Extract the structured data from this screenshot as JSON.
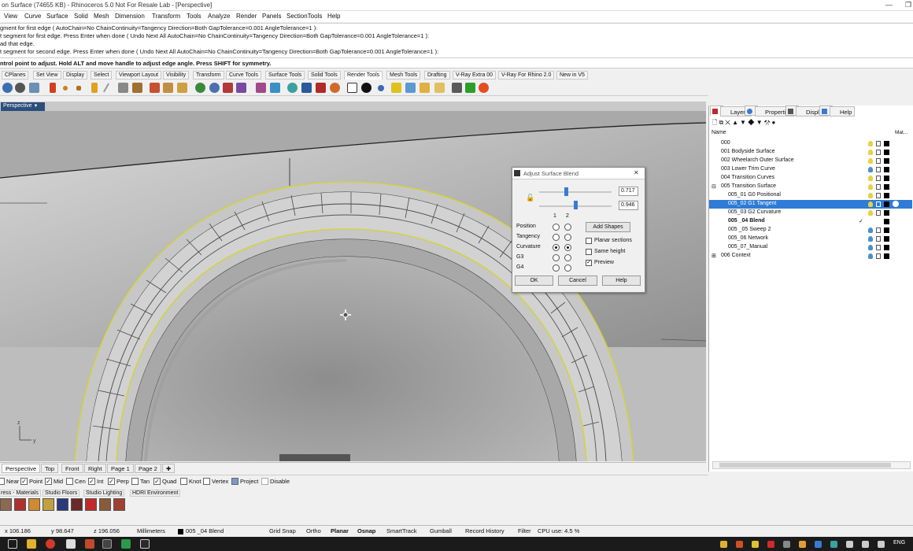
{
  "window": {
    "title": "on Surface (74655 KB) - Rhinoceros 5.0 Not For Resale Lab - [Perspective]",
    "restore_glyph": "❐"
  },
  "menu": [
    "View",
    "Curve",
    "Surface",
    "Solid",
    "Mesh",
    "Dimension",
    "Transform",
    "Tools",
    "Analyze",
    "Render",
    "Panels",
    "SectionTools",
    "Help"
  ],
  "command_history": [
    "gment for first edge ( AutoChain=No  ChainContinuity=Tangency  Direction=Both  GapTolerance=0.001  AngleTolerance=1 ):",
    "t segment for first edge. Press Enter when done ( Undo  Next  All  AutoChain=No  ChainContinuity=Tangency  Direction=Both  GapTolerance=0.001  AngleTolerance=1 ):",
    "ad that edge.",
    "t segment for second edge. Press Enter when done ( Undo  Next  All  AutoChain=No  ChainContinuity=Tangency  Direction=Both  GapTolerance=0.001  AngleTolerance=1 ):"
  ],
  "command_prompt": "ntrol point to adjust. Hold ALT and move handle to adjust edge angle. Press SHIFT for symmetry.",
  "toolbar_tabs": [
    "CPlanes",
    "Set View",
    "Display",
    "Select",
    "Viewport Layout",
    "Visibility",
    "Transform",
    "Curve Tools",
    "Surface Tools",
    "Solid Tools",
    "Render Tools",
    "Mesh Tools",
    "Drafting",
    "V-Ray Extra 00",
    "V-Ray For Rhino 2.0",
    "New in V5"
  ],
  "active_toolbar_tab": "Render Tools",
  "viewport": {
    "title": "Perspective",
    "axis_z": "z",
    "axis_y": "y"
  },
  "viewport_tabs": [
    "Perspective",
    "Top",
    "Front",
    "Right",
    "Page 1",
    "Page 2"
  ],
  "add_tab_glyph": "✚",
  "osnaps": [
    {
      "label": "Near",
      "checked": false
    },
    {
      "label": "Point",
      "checked": true
    },
    {
      "label": "Mid",
      "checked": true
    },
    {
      "label": "Cen",
      "checked": false
    },
    {
      "label": "Int",
      "checked": true
    },
    {
      "label": "Perp",
      "checked": true
    },
    {
      "label": "Tan",
      "checked": false
    },
    {
      "label": "Quad",
      "checked": true
    },
    {
      "label": "Knot",
      "checked": false
    },
    {
      "label": "Vertex",
      "checked": false
    },
    {
      "label": "Project",
      "checked": true
    },
    {
      "label": "Disable",
      "checked": false
    }
  ],
  "material_tabs": [
    "ress - Materials",
    "Studio Floors",
    "Studio Lighting",
    "HDRI Environment"
  ],
  "status": {
    "x": "x 106.186",
    "y": "y 98.647",
    "z": "z 196.056",
    "units": "Millimeters",
    "layer": "005 _04 Blend",
    "toggles": [
      "Grid Snap",
      "Ortho",
      "Planar",
      "Osnap",
      "SmartTrack",
      "Gumball",
      "Record History",
      "Filter"
    ],
    "cpu": "CPU use: 4.5 %"
  },
  "taskbar": {
    "lang": "ENG"
  },
  "panel": {
    "tabs": [
      "Layers",
      "Properties",
      "Display",
      "Help"
    ],
    "active_tab": "Layers",
    "column_name": "Name",
    "column_mat": "Mat...",
    "layers": [
      {
        "name": "000",
        "indent": 0,
        "bulb": "on",
        "lock": true,
        "color": "#000000"
      },
      {
        "name": "001 Bodyside Surface",
        "indent": 0,
        "bulb": "on",
        "lock": true,
        "color": "#000000"
      },
      {
        "name": "002 Wheelarch Outer Surface",
        "indent": 0,
        "bulb": "on",
        "lock": true,
        "color": "#000000"
      },
      {
        "name": "003 Lower Trim Curve",
        "indent": 0,
        "bulb": "off",
        "lock": true,
        "color": "#000000"
      },
      {
        "name": "004 Transition Curves",
        "indent": 0,
        "bulb": "on",
        "lock": true,
        "color": "#000000"
      },
      {
        "name": "005 Transition Surface",
        "indent": 0,
        "expand": "⊟",
        "bulb": "on",
        "lock": true,
        "color": "#000000"
      },
      {
        "name": "005_01 G0 Positional",
        "indent": 1,
        "bulb": "on",
        "lock": true,
        "color": "#000000"
      },
      {
        "name": "005_02 G1 Tangent",
        "indent": 1,
        "bulb": "on",
        "lock": true,
        "color": "#000000",
        "selected": true
      },
      {
        "name": "005_03 G2 Curvature",
        "indent": 1,
        "bulb": "on",
        "lock": true,
        "color": "#000000"
      },
      {
        "name": "005 _04 Blend",
        "indent": 1,
        "bold": true,
        "current": "✓",
        "color": "#000000"
      },
      {
        "name": "005 _05 Sweep 2",
        "indent": 1,
        "bulb": "off",
        "lock": true,
        "color": "#000000"
      },
      {
        "name": "005_06 Network",
        "indent": 1,
        "bulb": "off",
        "lock": true,
        "color": "#000000"
      },
      {
        "name": "005_07_Manual",
        "indent": 1,
        "bulb": "off",
        "lock": true,
        "color": "#000000"
      },
      {
        "name": "006 Context",
        "indent": 0,
        "expand": "⊞",
        "bulb": "off",
        "lock": true,
        "color": "#000000"
      }
    ]
  },
  "dialog": {
    "title": "Adjust Surface Blend",
    "slider1_value": "0.717",
    "slider2_value": "0.946",
    "slider1_level": 0.717,
    "slider2_level": 0.946,
    "col1": "1",
    "col2": "2",
    "rows": [
      {
        "label": "Position",
        "sel": 0
      },
      {
        "label": "Tangency",
        "sel": 0
      },
      {
        "label": "Curvature",
        "sel": 3
      },
      {
        "label": "G3",
        "sel": 0
      },
      {
        "label": "G4",
        "sel": 0
      }
    ],
    "add_shapes": "Add Shapes",
    "checks": [
      {
        "label": "Planar sections",
        "checked": false
      },
      {
        "label": "Same height",
        "checked": false
      },
      {
        "label": "Preview",
        "checked": true
      }
    ],
    "ok": "OK",
    "cancel": "Cancel",
    "help": "Help",
    "close_glyph": "✕"
  }
}
